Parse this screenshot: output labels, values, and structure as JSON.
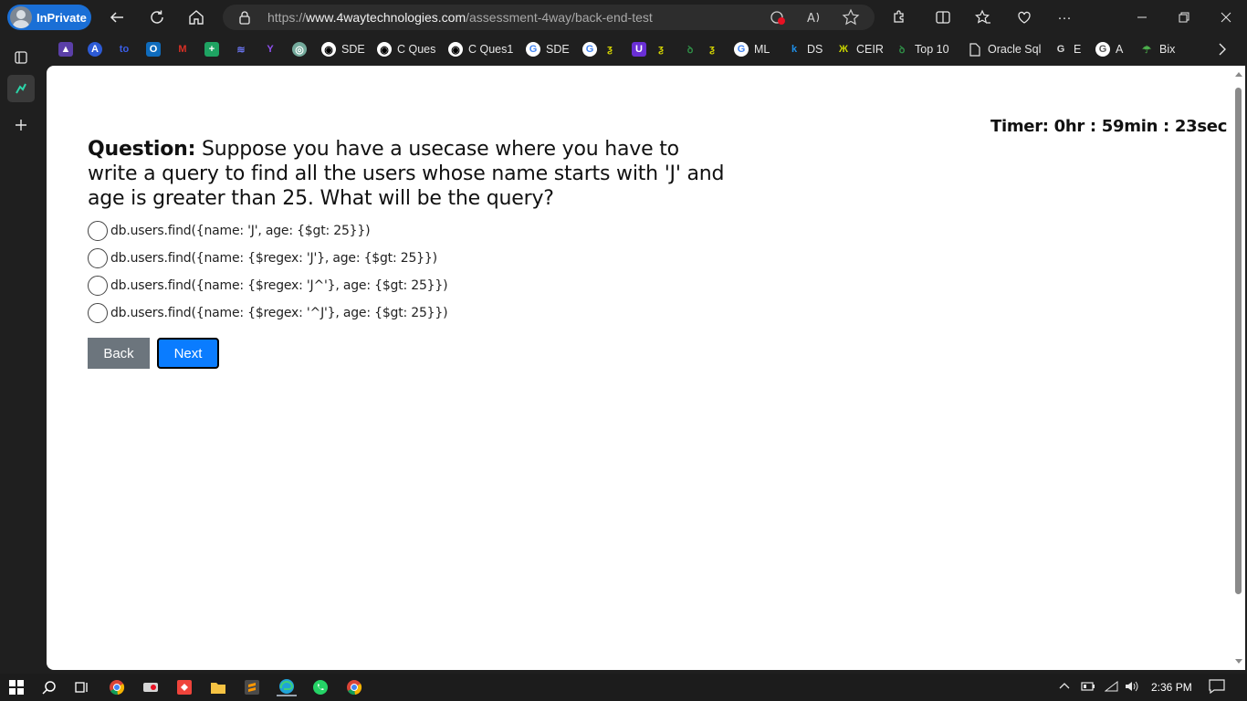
{
  "browser": {
    "inprivate_label": "InPrivate",
    "url_prefix": "https://",
    "url_domain": "www.4waytechnologies.com",
    "url_path": "/assessment-4way/back-end-test"
  },
  "favorites": [
    {
      "icon": "purple-app-icon",
      "label": "",
      "color": "#5b3fa8"
    },
    {
      "icon": "blue-circle-icon",
      "label": "",
      "color": "#2d5bd6"
    },
    {
      "icon": "to-icon",
      "label": "",
      "color": "#3a5ee8"
    },
    {
      "icon": "outlook-icon",
      "label": "",
      "color": "#0f6cbd"
    },
    {
      "icon": "gmail-icon",
      "label": "",
      "color": "#d93025"
    },
    {
      "icon": "sheets-icon",
      "label": "",
      "color": "#1ea362"
    },
    {
      "icon": "swirl-icon",
      "label": "",
      "color": "#4a55e0"
    },
    {
      "icon": "yahoo-icon",
      "label": "",
      "color": "#6001d2"
    },
    {
      "icon": "openai-icon",
      "label": "",
      "color": "#74aa9c"
    },
    {
      "icon": "github-icon",
      "label": "SDE"
    },
    {
      "icon": "github-icon",
      "label": "C Ques"
    },
    {
      "icon": "github-icon",
      "label": "C Ques1"
    },
    {
      "icon": "google-icon",
      "label": "SDE"
    },
    {
      "icon": "google-icon",
      "label": ""
    },
    {
      "icon": "yellow-flag-icon",
      "label": ""
    },
    {
      "icon": "purple-u-icon",
      "label": ""
    },
    {
      "icon": "yellow-flag-icon",
      "label": ""
    },
    {
      "icon": "gfg-icon",
      "label": ""
    },
    {
      "icon": "yellow-flag-icon",
      "label": ""
    },
    {
      "icon": "google-icon",
      "label": "ML"
    },
    {
      "icon": "k-icon",
      "label": "DS"
    },
    {
      "icon": "ceir-icon",
      "label": "CEIR"
    },
    {
      "icon": "gfg-icon",
      "label": "Top 10"
    },
    {
      "icon": "document-icon",
      "label": "Oracle Sql"
    },
    {
      "icon": "google-icon",
      "label": "E"
    },
    {
      "icon": "google-icon",
      "label": "A"
    },
    {
      "icon": "bix-icon",
      "label": "Bix"
    }
  ],
  "page": {
    "timer": "Timer: 0hr : 59min : 23sec",
    "question_label": "Question:",
    "question_text": " Suppose you have a usecase where you have to write a query to find all the users whose name starts with 'J' and age is greater than 25. What will be the query?",
    "options": [
      "db.users.find({name: 'J', age: {$gt: 25}})",
      "db.users.find({name: {$regex: 'J'}, age: {$gt: 25}})",
      "db.users.find({name: {$regex: 'J^'}, age: {$gt: 25}})",
      "db.users.find({name: {$regex: '^J'}, age: {$gt: 25}})"
    ],
    "back_label": "Back",
    "next_label": "Next"
  },
  "taskbar": {
    "time": "2:36 PM"
  },
  "colors": {
    "next_button": "#0a7cff",
    "back_button": "#6c757d",
    "inprivate_badge": "#1a6fd6"
  }
}
